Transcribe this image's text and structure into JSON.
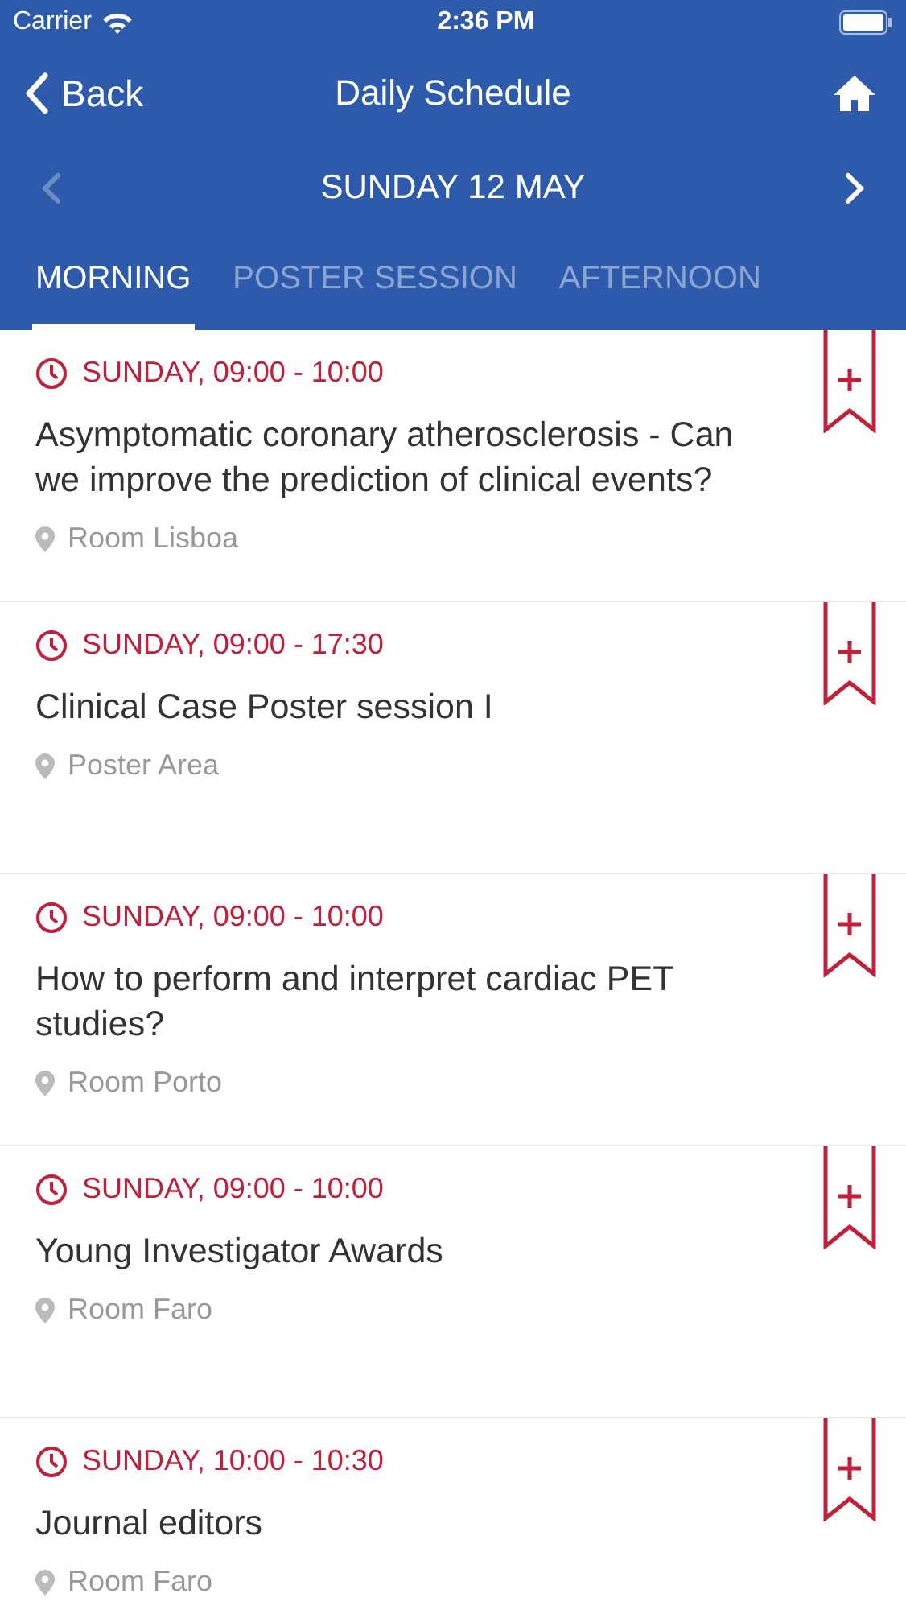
{
  "status_bar": {
    "carrier": "Carrier",
    "time": "2:36 PM"
  },
  "nav": {
    "back": "Back",
    "title": "Daily Schedule"
  },
  "date_bar": {
    "date": "SUNDAY 12 MAY",
    "prev_disabled": true,
    "next_disabled": false
  },
  "tabs": [
    {
      "label": "MORNING",
      "selected": true
    },
    {
      "label": "POSTER SESSION",
      "selected": false
    },
    {
      "label": "AFTERNOON",
      "selected": false
    }
  ],
  "sessions": [
    {
      "time": "SUNDAY, 09:00 - 10:00",
      "title": "Asymptomatic coronary atherosclerosis - Can we improve the prediction of clinical events?",
      "location": "Room Lisboa"
    },
    {
      "time": "SUNDAY, 09:00 - 17:30",
      "title": "Clinical Case Poster session I",
      "location": "Poster Area"
    },
    {
      "time": "SUNDAY, 09:00 - 10:00",
      "title": "How to perform and interpret cardiac PET studies?",
      "location": "Room Porto"
    },
    {
      "time": "SUNDAY, 09:00 - 10:00",
      "title": "Young Investigator Awards",
      "location": "Room Faro"
    },
    {
      "time": "SUNDAY, 10:00 - 10:30",
      "title": "Journal editors",
      "location": "Room Faro"
    }
  ]
}
